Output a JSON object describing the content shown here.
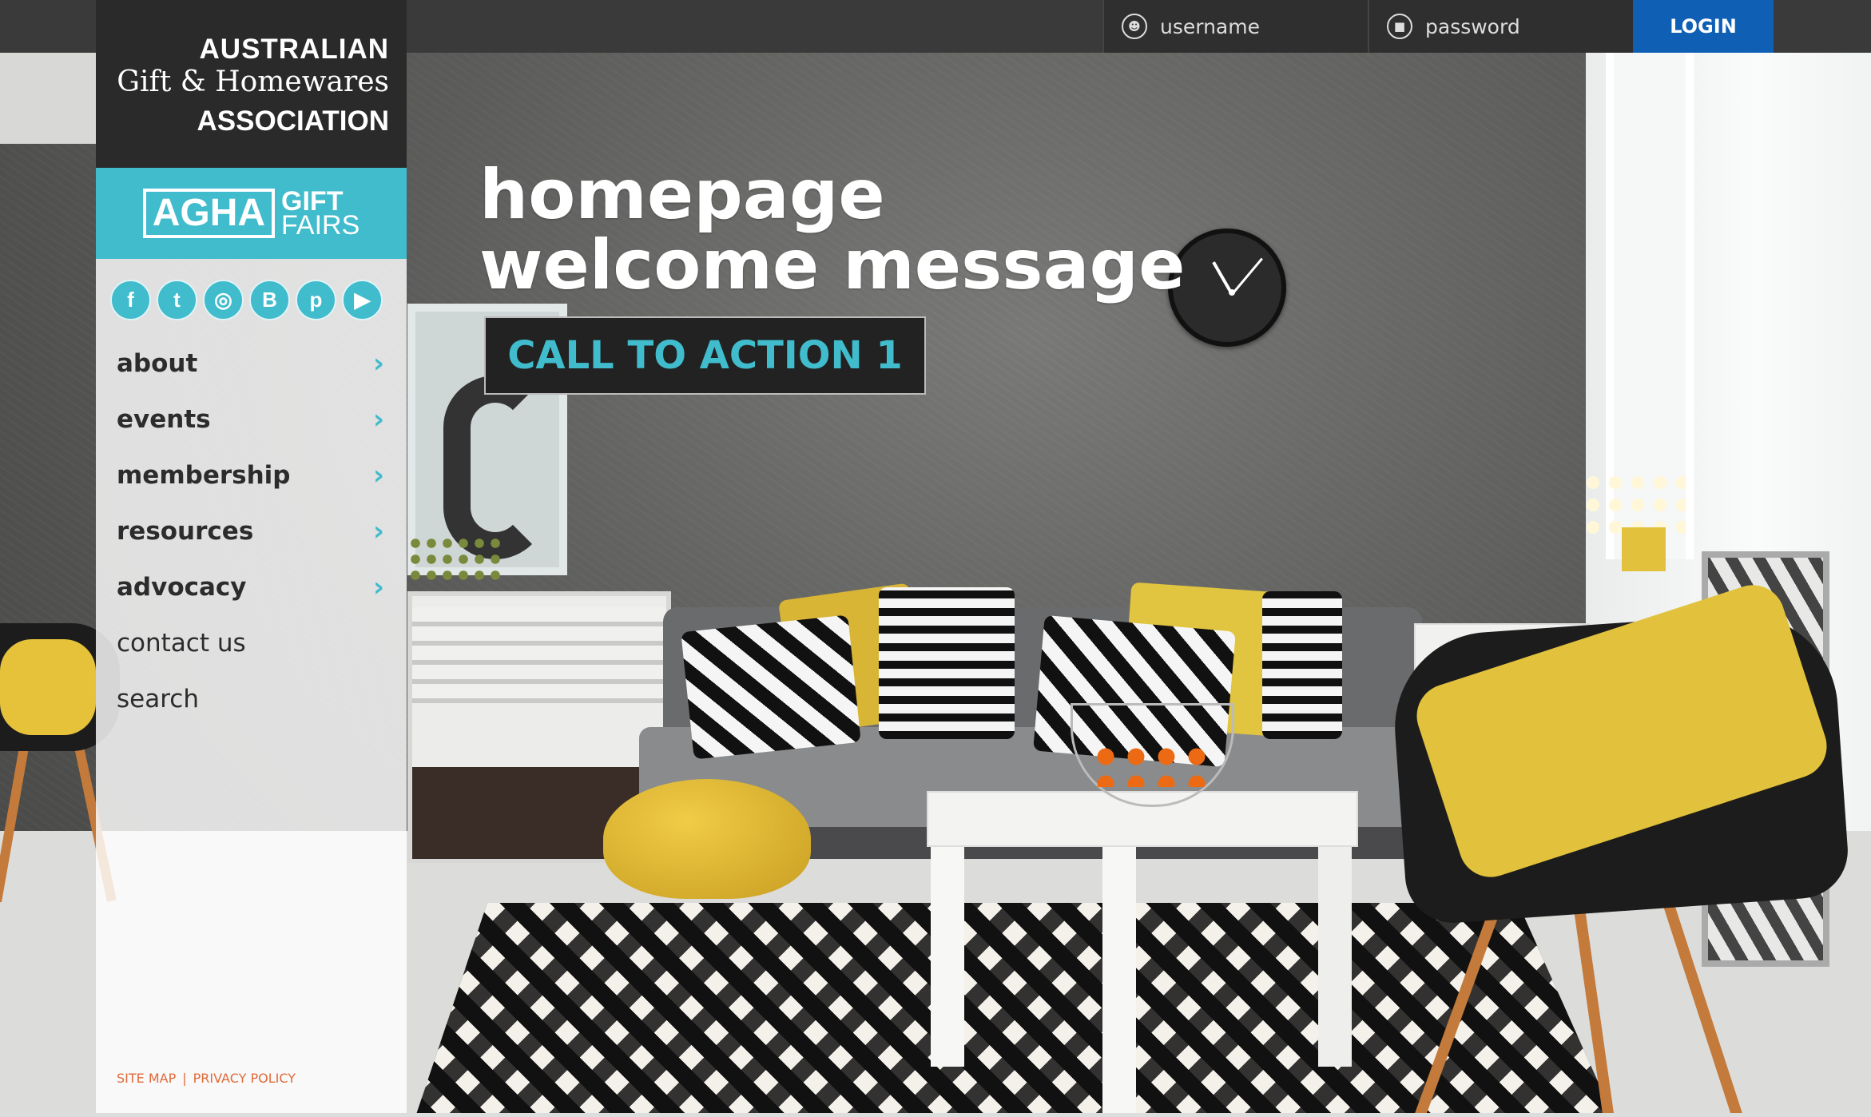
{
  "topbar": {
    "username_placeholder": "username",
    "password_placeholder": "password",
    "login_label": "LOGIN",
    "login_color": "#0f5fb4"
  },
  "logo": {
    "line1": "AUSTRALIAN",
    "line2": "Gift & Homewares",
    "line3": "ASSOCIATION"
  },
  "fairs": {
    "agha": "AGHA",
    "gift": "GIFT",
    "fairs": "FAIRS",
    "color": "#40bccd"
  },
  "social": [
    {
      "name": "facebook-icon",
      "glyph": "f"
    },
    {
      "name": "twitter-icon",
      "glyph": "t"
    },
    {
      "name": "instagram-icon",
      "glyph": "◎"
    },
    {
      "name": "blogger-icon",
      "glyph": "B"
    },
    {
      "name": "pinterest-icon",
      "glyph": "p"
    },
    {
      "name": "youtube-icon",
      "glyph": "▶"
    }
  ],
  "nav": [
    {
      "label": "about",
      "has_sub": true
    },
    {
      "label": "events",
      "has_sub": true
    },
    {
      "label": "membership",
      "has_sub": true
    },
    {
      "label": "resources",
      "has_sub": true
    },
    {
      "label": "advocacy",
      "has_sub": true
    },
    {
      "label": "contact us",
      "has_sub": false
    },
    {
      "label": "search",
      "has_sub": false
    }
  ],
  "footer": {
    "sitemap": "SITE MAP",
    "separator": "|",
    "privacy": "PRIVACY POLICY"
  },
  "hero": {
    "welcome": "homepage welcome message",
    "cta": "CALL TO ACTION 1"
  }
}
